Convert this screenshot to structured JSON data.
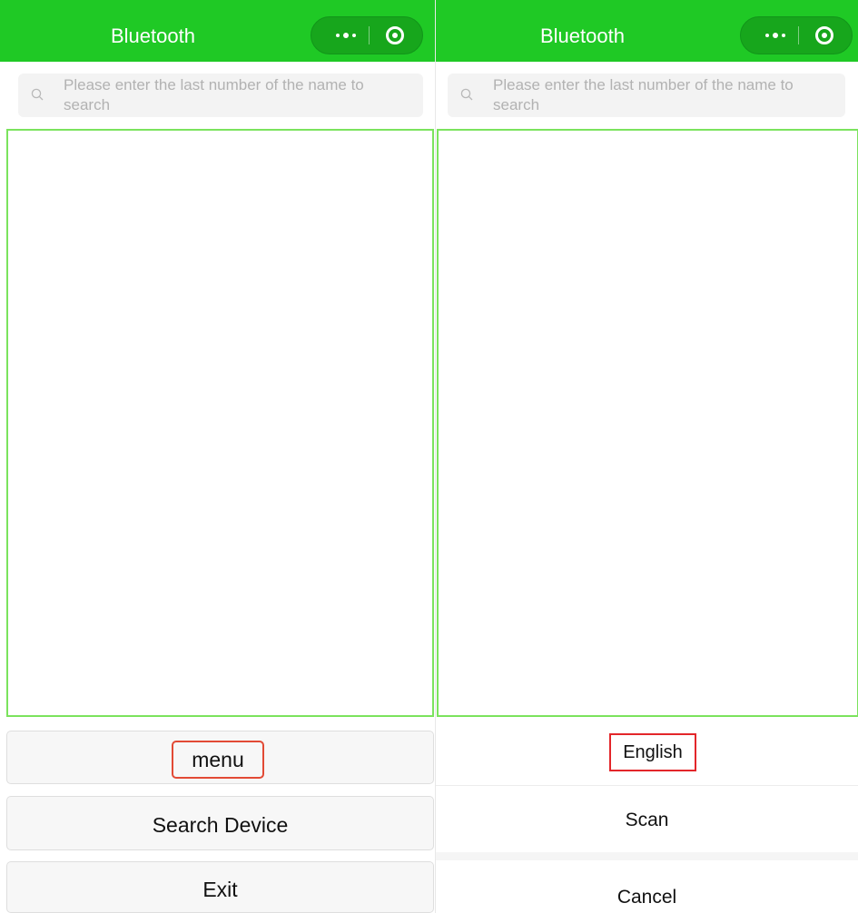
{
  "screens": [
    {
      "header": {
        "title": "Bluetooth"
      },
      "capsule": {
        "more_icon": "more-dots-icon",
        "close_icon": "target-circle-icon"
      },
      "search": {
        "placeholder": "Please enter the last number of the name to search",
        "icon": "search-icon"
      },
      "buttons": {
        "menu": "menu",
        "search_device": "Search Device",
        "exit": "Exit"
      }
    },
    {
      "header": {
        "title": "Bluetooth"
      },
      "capsule": {
        "more_icon": "more-dots-icon",
        "close_icon": "target-circle-icon"
      },
      "search": {
        "placeholder": "Please enter the last number of the name to search",
        "icon": "search-icon"
      },
      "action_sheet": {
        "english": "English",
        "scan": "Scan",
        "cancel": "Cancel"
      }
    }
  ],
  "colors": {
    "header_green": "#1fc925",
    "list_border": "#7be35d",
    "highlight_red": "#e24a35"
  }
}
